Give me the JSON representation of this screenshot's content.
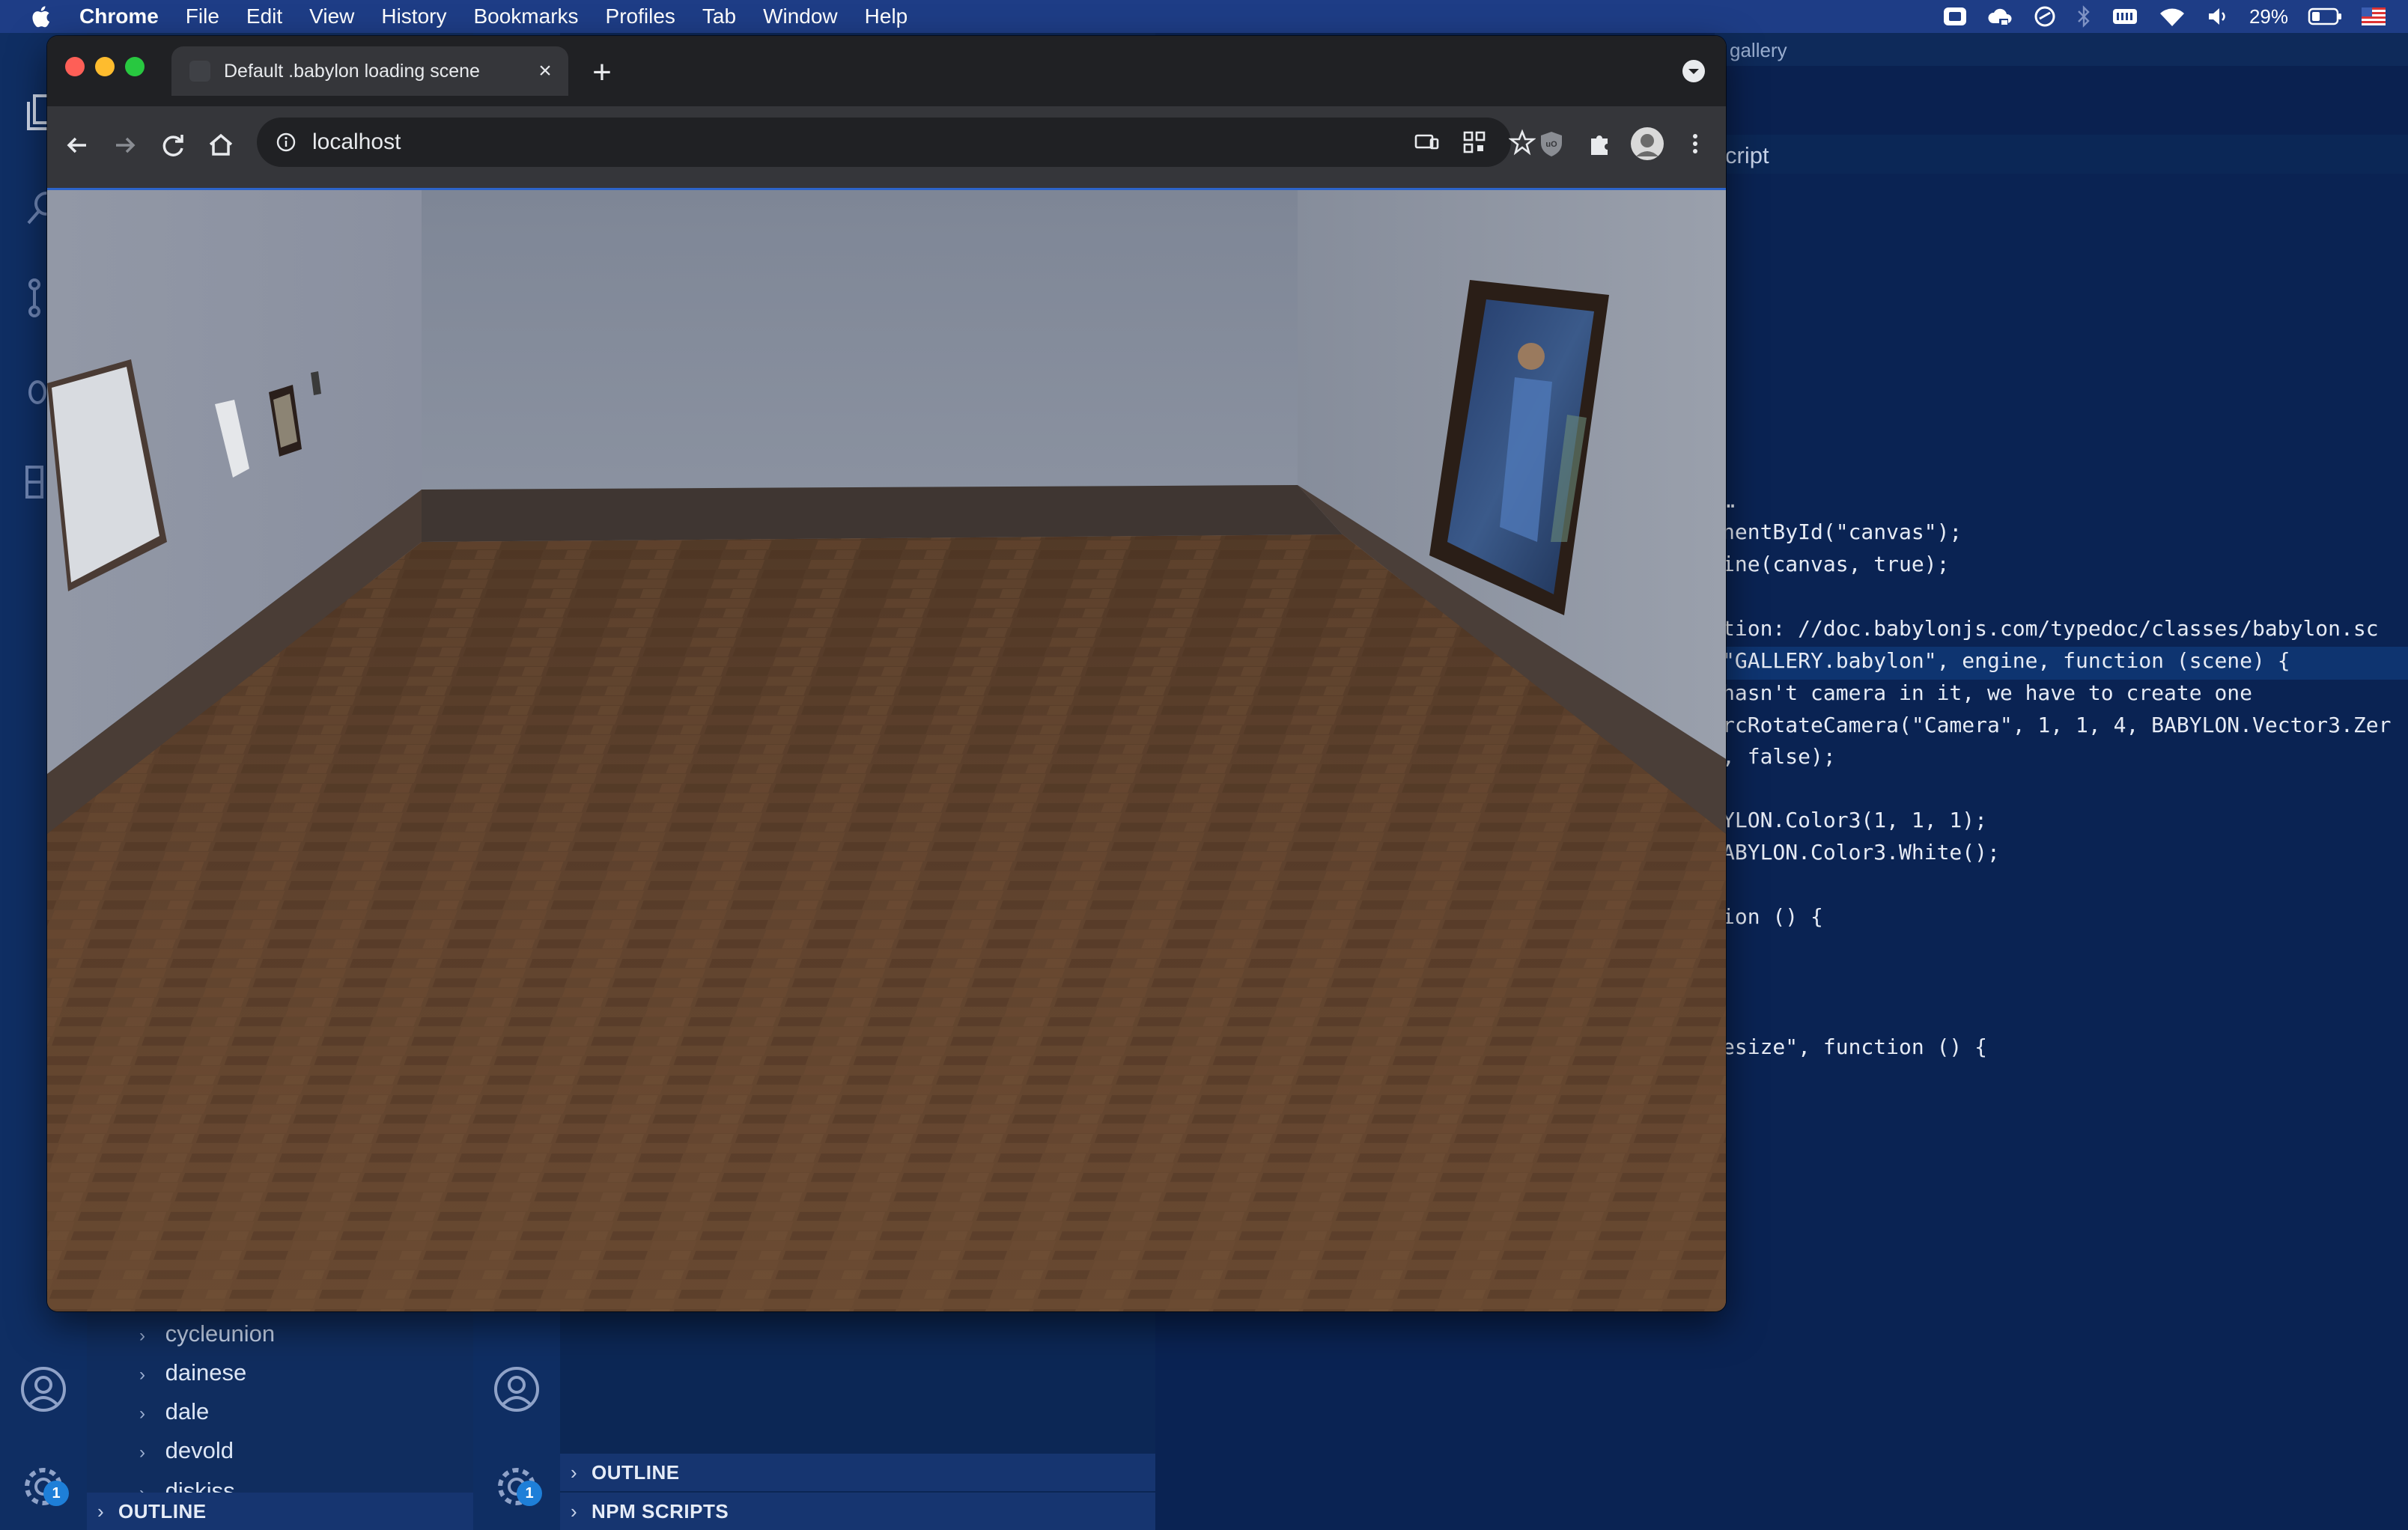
{
  "menubar": {
    "app": "Chrome",
    "items": [
      "File",
      "Edit",
      "View",
      "History",
      "Bookmarks",
      "Profiles",
      "Tab",
      "Window",
      "Help"
    ],
    "battery_percent": "29%"
  },
  "browser": {
    "tab_title": "Default .babylon loading scene",
    "url": "localhost",
    "accent_color": "#2d64c9"
  },
  "vscode": {
    "window_title_fragment": "gallery",
    "breadcrumb_fragment": "cript",
    "code_lines": [
      "…",
      "nentById(\"canvas\");",
      "ine(canvas, true);",
      "",
      "tion: //doc.babylonjs.com/typedoc/classes/babylon.sc",
      "\"GALLERY.babylon\", engine, function (scene) {",
      "hasn't camera in it, we have to create one",
      "rcRotateCamera(\"Camera\", 1, 1, 4, BABYLON.Vector3.Zer",
      ", false);",
      "",
      "YLON.Color3(1, 1, 1);",
      "ABYLON.Color3.White();",
      "",
      "ion () {",
      "",
      "",
      "",
      "esize\", function () {"
    ],
    "explorer_items": [
      "cycleunion",
      "dainese",
      "dale",
      "devold",
      "diskiss"
    ],
    "outline_label": "OUTLINE",
    "npm_scripts_label": "NPM SCRIPTS",
    "settings_badge": "1"
  }
}
